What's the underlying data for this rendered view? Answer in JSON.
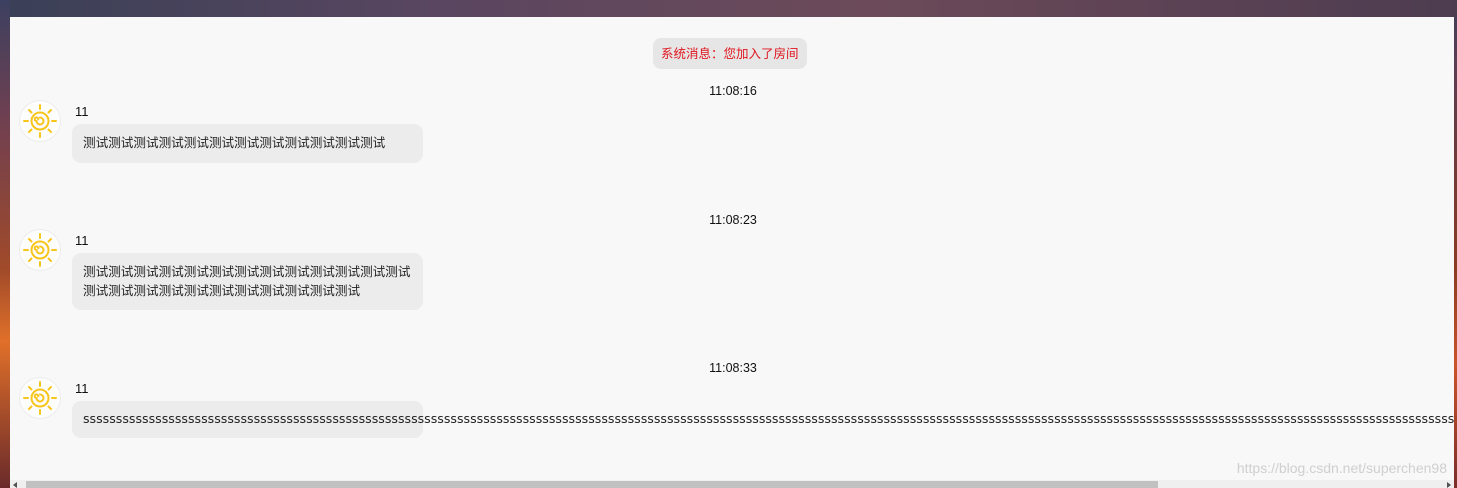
{
  "system_message": "系统消息：您加入了房间",
  "messages": [
    {
      "time": "11:08:16",
      "user": "11",
      "avatar_icon": "sun-icon",
      "text": "测试测试测试测试测试测试测试测试测试测试测试测试"
    },
    {
      "time": "11:08:23",
      "user": "11",
      "avatar_icon": "sun-icon",
      "text": "测试测试测试测试测试测试测试测试测试测试测试测试测试测试测试测试测试测试测试测试测试测试测试测试"
    },
    {
      "time": "11:08:33",
      "user": "11",
      "avatar_icon": "sun-icon",
      "text": "ssssssssssssssssssssssssssssssssssssssssssssssssssssssssssssssssssssssssssssssssssssssssssssssssssssssssssssssssssssssssssssssssssssssssssssssssssssssssssssssssssssssssssssssssssssssssssssssssssssssssssssssssssssssssssssssssssssssssssssssss"
    }
  ],
  "watermark": "https://blog.csdn.net/superchen98",
  "colors": {
    "system_text": "#e0141e",
    "bubble_bg": "#ececec",
    "window_bg": "#f8f8f8",
    "sun": "#f7c51b"
  }
}
